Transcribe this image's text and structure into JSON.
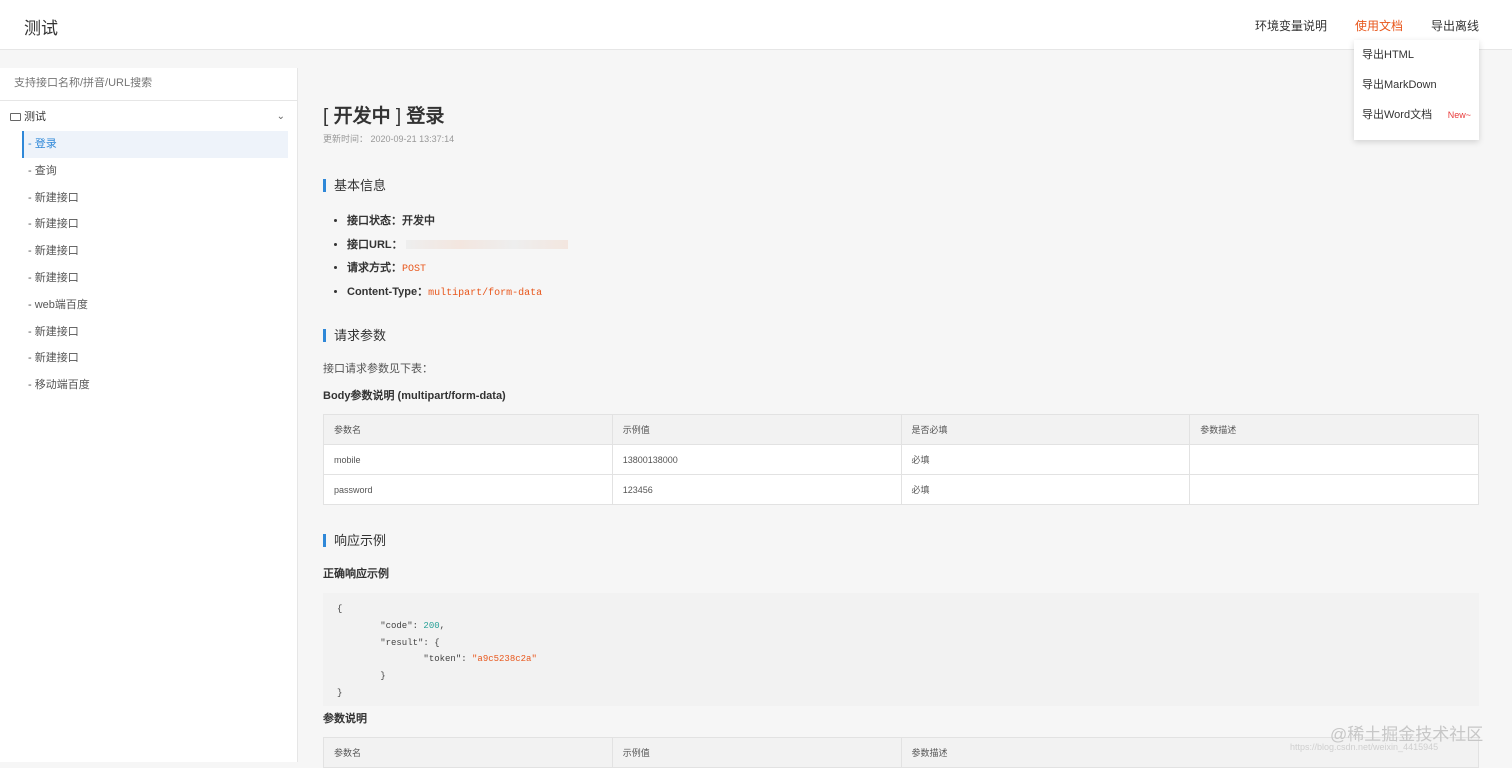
{
  "header": {
    "title": "测试",
    "nav": [
      "环境变量说明",
      "使用文档",
      "导出离线"
    ],
    "active_nav": 1,
    "export_menu": {
      "items": [
        "导出HTML",
        "导出MarkDown",
        "导出Word文档"
      ],
      "new_badge": "New~"
    }
  },
  "sidebar": {
    "search_placeholder": "支持接口名称/拼音/URL搜索",
    "root": "测试",
    "items": [
      {
        "label": "- 登录",
        "active": true
      },
      {
        "label": "- 查询"
      },
      {
        "label": "- 新建接口"
      },
      {
        "label": "- 新建接口"
      },
      {
        "label": "- 新建接口"
      },
      {
        "label": "- 新建接口"
      },
      {
        "label": "- web端百度"
      },
      {
        "label": "- 新建接口"
      },
      {
        "label": "- 新建接口"
      },
      {
        "label": "- 移动端百度"
      }
    ]
  },
  "doc": {
    "status_prefix": "[ ",
    "status": "开发中",
    "status_suffix": " ]",
    "name": "登录",
    "updated_label": "更新时间：",
    "updated_value": "2020-09-21 13:37:14",
    "basic": {
      "title": "基本信息",
      "status_label": "接口状态：",
      "status_value": "开发中",
      "url_label": "接口URL：",
      "method_label": "请求方式：",
      "method_value": "POST",
      "ctype_label": "Content-Type：",
      "ctype_value": "multipart/form-data"
    },
    "request": {
      "title": "请求参数",
      "intro": "接口请求参数见下表：",
      "body_title": "Body参数说明 (multipart/form-data)",
      "columns": [
        "参数名",
        "示例值",
        "是否必填",
        "参数描述"
      ],
      "rows": [
        [
          "mobile",
          "13800138000",
          "必填",
          ""
        ],
        [
          "password",
          "123456",
          "必填",
          ""
        ]
      ]
    },
    "response": {
      "title": "响应示例",
      "ok_title": "正确响应示例",
      "code_lines": [
        "{",
        "        \"code\": 200,",
        "        \"result\": {",
        "                \"token\": \"a9c5238c2a\"",
        "        }",
        "}"
      ],
      "param_title": "参数说明",
      "param_columns": [
        "参数名",
        "示例值",
        "参数描述"
      ]
    }
  },
  "watermark": {
    "main": "@稀土掘金技术社区",
    "sub": "https://blog.csdn.net/weixin_4415945"
  }
}
